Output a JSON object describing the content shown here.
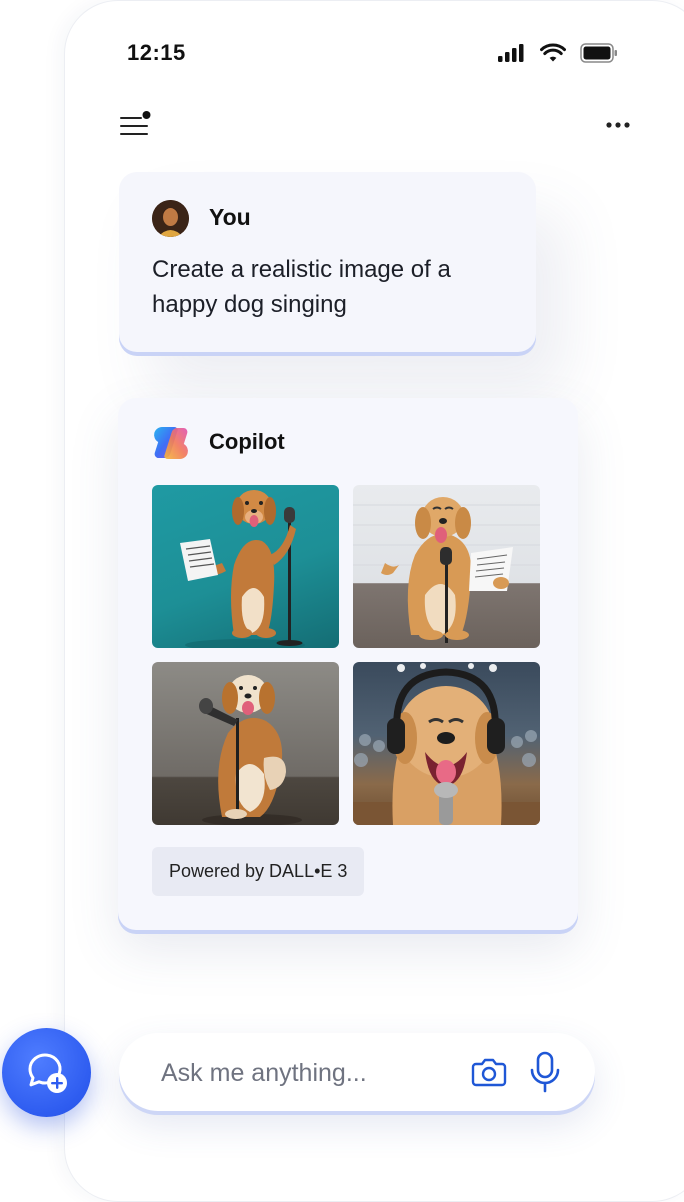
{
  "status": {
    "time": "12:15"
  },
  "conversation": {
    "user": {
      "name": "You",
      "message": "Create a realistic image of a happy dog singing"
    },
    "copilot": {
      "name": "Copilot",
      "images": [
        {
          "alt": "Golden retriever standing with sheet music and a microphone on teal background"
        },
        {
          "alt": "Golden retriever singing into a microphone holding a lyrics sheet"
        },
        {
          "alt": "Golden retriever singing into a standing microphone"
        },
        {
          "alt": "Golden retriever wearing headphones singing on stage"
        }
      ],
      "powered_by": "Powered by DALL•E 3"
    }
  },
  "composer": {
    "placeholder": "Ask me anything..."
  },
  "colors": {
    "accent": "#2e5cf0",
    "card_bg": "#f5f6fc",
    "icon_blue": "#1f57d6"
  },
  "icons": [
    "menu-icon",
    "more-icon",
    "signal-icon",
    "wifi-icon",
    "battery-icon",
    "copilot-logo",
    "new-chat-icon",
    "camera-icon",
    "microphone-icon"
  ]
}
